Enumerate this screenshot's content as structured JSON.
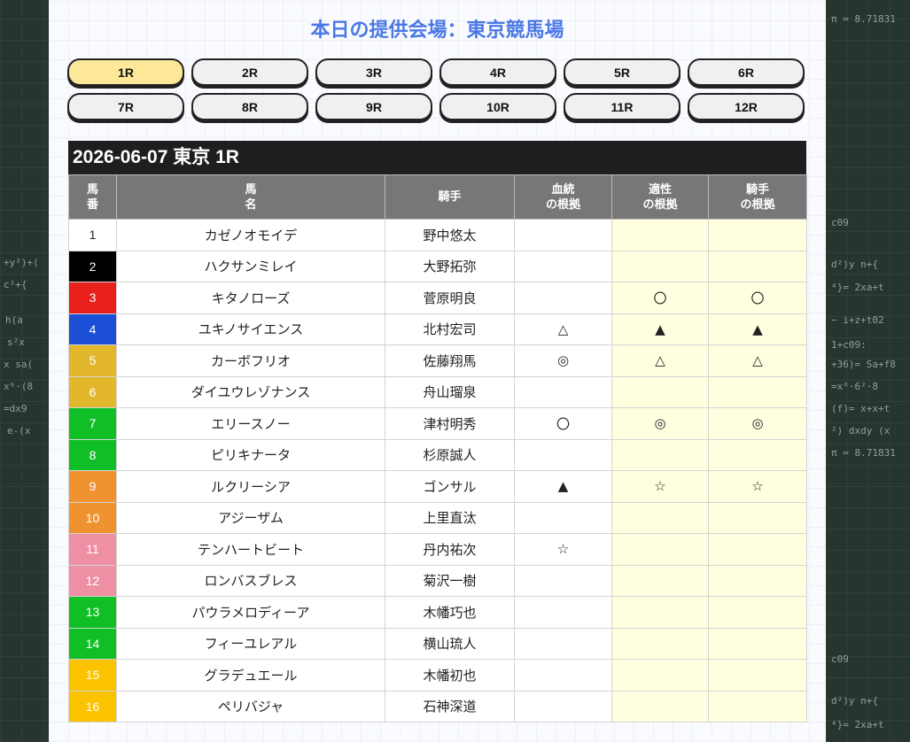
{
  "header": {
    "title": "本日の提供会場：東京競馬場"
  },
  "races": [
    {
      "label": "1R",
      "active": true
    },
    {
      "label": "2R"
    },
    {
      "label": "3R"
    },
    {
      "label": "4R"
    },
    {
      "label": "5R"
    },
    {
      "label": "6R"
    },
    {
      "label": "7R"
    },
    {
      "label": "8R"
    },
    {
      "label": "9R"
    },
    {
      "label": "10R"
    },
    {
      "label": "11R"
    },
    {
      "label": "12R"
    }
  ],
  "race_title": "2026-06-07 東京 1R",
  "columns": {
    "num_l1": "馬",
    "num_l2": "番",
    "name_l1": "馬",
    "name_l2": "名",
    "jockey": "騎手",
    "blood_l1": "血統",
    "blood_l2": "の根拠",
    "apt_l1": "適性",
    "apt_l2": "の根拠",
    "jock_l1": "騎手",
    "jock_l2": "の根拠"
  },
  "colors": {
    "frame1": "#ffffff",
    "frame2": "#000000",
    "frame3": "#e8201c",
    "frame4": "#1b4fd6",
    "frame5": "#e2b72b",
    "frame6": "#e2b72b",
    "frame7": "#0fbf25",
    "frame8": "#0fbf25",
    "frame9": "#ef9332",
    "frame10": "#ef9332",
    "frame11": "#ef8fa4",
    "frame12": "#ef8fa4",
    "frame13": "#0fbf25",
    "frame14": "#0fbf25",
    "frame15": "#fbc200",
    "frame16": "#fbc200"
  },
  "horses": [
    {
      "num": "1",
      "name": "カゼノオモイデ",
      "jockey": "野中悠太",
      "blood": "",
      "apt": "",
      "jock": ""
    },
    {
      "num": "2",
      "name": "ハクサンミレイ",
      "jockey": "大野拓弥",
      "blood": "",
      "apt": "",
      "jock": ""
    },
    {
      "num": "3",
      "name": "キタノローズ",
      "jockey": "菅原明良",
      "blood": "",
      "apt": "〇",
      "jock": "〇"
    },
    {
      "num": "4",
      "name": "ユキノサイエンス",
      "jockey": "北村宏司",
      "blood": "△",
      "apt": "▲",
      "jock": "▲"
    },
    {
      "num": "5",
      "name": "カーボフリオ",
      "jockey": "佐藤翔馬",
      "blood": "◎",
      "apt": "△",
      "jock": "△"
    },
    {
      "num": "6",
      "name": "ダイユウレゾナンス",
      "jockey": "舟山瑠泉",
      "blood": "",
      "apt": "",
      "jock": ""
    },
    {
      "num": "7",
      "name": "エリースノー",
      "jockey": "津村明秀",
      "blood": "〇",
      "apt": "◎",
      "jock": "◎"
    },
    {
      "num": "8",
      "name": "ピリキナータ",
      "jockey": "杉原誠人",
      "blood": "",
      "apt": "",
      "jock": ""
    },
    {
      "num": "9",
      "name": "ルクリーシア",
      "jockey": "ゴンサル",
      "blood": "▲",
      "apt": "☆",
      "jock": "☆"
    },
    {
      "num": "10",
      "name": "アジーザム",
      "jockey": "上里直汰",
      "blood": "",
      "apt": "",
      "jock": ""
    },
    {
      "num": "11",
      "name": "テンハートビート",
      "jockey": "丹内祐次",
      "blood": "☆",
      "apt": "",
      "jock": ""
    },
    {
      "num": "12",
      "name": "ロンバスブレス",
      "jockey": "菊沢一樹",
      "blood": "",
      "apt": "",
      "jock": ""
    },
    {
      "num": "13",
      "name": "パウラメロディーア",
      "jockey": "木幡巧也",
      "blood": "",
      "apt": "",
      "jock": ""
    },
    {
      "num": "14",
      "name": "フィーユレアル",
      "jockey": "横山琉人",
      "blood": "",
      "apt": "",
      "jock": ""
    },
    {
      "num": "15",
      "name": "グラデュエール",
      "jockey": "木幡初也",
      "blood": "",
      "apt": "",
      "jock": ""
    },
    {
      "num": "16",
      "name": "ペリバジャ",
      "jockey": "石神深道",
      "blood": "",
      "apt": "",
      "jock": ""
    }
  ]
}
